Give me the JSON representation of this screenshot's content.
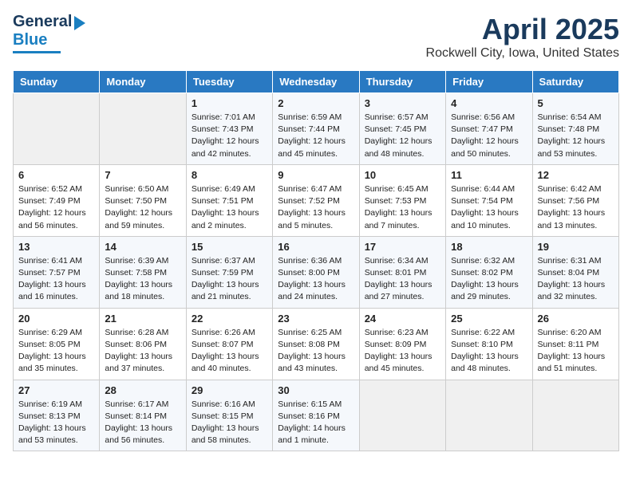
{
  "header": {
    "logo_line1": "General",
    "logo_line2": "Blue",
    "month_title": "April 2025",
    "location": "Rockwell City, Iowa, United States"
  },
  "days_of_week": [
    "Sunday",
    "Monday",
    "Tuesday",
    "Wednesday",
    "Thursday",
    "Friday",
    "Saturday"
  ],
  "weeks": [
    [
      {
        "day": "",
        "info": ""
      },
      {
        "day": "",
        "info": ""
      },
      {
        "day": "1",
        "info": "Sunrise: 7:01 AM\nSunset: 7:43 PM\nDaylight: 12 hours\nand 42 minutes."
      },
      {
        "day": "2",
        "info": "Sunrise: 6:59 AM\nSunset: 7:44 PM\nDaylight: 12 hours\nand 45 minutes."
      },
      {
        "day": "3",
        "info": "Sunrise: 6:57 AM\nSunset: 7:45 PM\nDaylight: 12 hours\nand 48 minutes."
      },
      {
        "day": "4",
        "info": "Sunrise: 6:56 AM\nSunset: 7:47 PM\nDaylight: 12 hours\nand 50 minutes."
      },
      {
        "day": "5",
        "info": "Sunrise: 6:54 AM\nSunset: 7:48 PM\nDaylight: 12 hours\nand 53 minutes."
      }
    ],
    [
      {
        "day": "6",
        "info": "Sunrise: 6:52 AM\nSunset: 7:49 PM\nDaylight: 12 hours\nand 56 minutes."
      },
      {
        "day": "7",
        "info": "Sunrise: 6:50 AM\nSunset: 7:50 PM\nDaylight: 12 hours\nand 59 minutes."
      },
      {
        "day": "8",
        "info": "Sunrise: 6:49 AM\nSunset: 7:51 PM\nDaylight: 13 hours\nand 2 minutes."
      },
      {
        "day": "9",
        "info": "Sunrise: 6:47 AM\nSunset: 7:52 PM\nDaylight: 13 hours\nand 5 minutes."
      },
      {
        "day": "10",
        "info": "Sunrise: 6:45 AM\nSunset: 7:53 PM\nDaylight: 13 hours\nand 7 minutes."
      },
      {
        "day": "11",
        "info": "Sunrise: 6:44 AM\nSunset: 7:54 PM\nDaylight: 13 hours\nand 10 minutes."
      },
      {
        "day": "12",
        "info": "Sunrise: 6:42 AM\nSunset: 7:56 PM\nDaylight: 13 hours\nand 13 minutes."
      }
    ],
    [
      {
        "day": "13",
        "info": "Sunrise: 6:41 AM\nSunset: 7:57 PM\nDaylight: 13 hours\nand 16 minutes."
      },
      {
        "day": "14",
        "info": "Sunrise: 6:39 AM\nSunset: 7:58 PM\nDaylight: 13 hours\nand 18 minutes."
      },
      {
        "day": "15",
        "info": "Sunrise: 6:37 AM\nSunset: 7:59 PM\nDaylight: 13 hours\nand 21 minutes."
      },
      {
        "day": "16",
        "info": "Sunrise: 6:36 AM\nSunset: 8:00 PM\nDaylight: 13 hours\nand 24 minutes."
      },
      {
        "day": "17",
        "info": "Sunrise: 6:34 AM\nSunset: 8:01 PM\nDaylight: 13 hours\nand 27 minutes."
      },
      {
        "day": "18",
        "info": "Sunrise: 6:32 AM\nSunset: 8:02 PM\nDaylight: 13 hours\nand 29 minutes."
      },
      {
        "day": "19",
        "info": "Sunrise: 6:31 AM\nSunset: 8:04 PM\nDaylight: 13 hours\nand 32 minutes."
      }
    ],
    [
      {
        "day": "20",
        "info": "Sunrise: 6:29 AM\nSunset: 8:05 PM\nDaylight: 13 hours\nand 35 minutes."
      },
      {
        "day": "21",
        "info": "Sunrise: 6:28 AM\nSunset: 8:06 PM\nDaylight: 13 hours\nand 37 minutes."
      },
      {
        "day": "22",
        "info": "Sunrise: 6:26 AM\nSunset: 8:07 PM\nDaylight: 13 hours\nand 40 minutes."
      },
      {
        "day": "23",
        "info": "Sunrise: 6:25 AM\nSunset: 8:08 PM\nDaylight: 13 hours\nand 43 minutes."
      },
      {
        "day": "24",
        "info": "Sunrise: 6:23 AM\nSunset: 8:09 PM\nDaylight: 13 hours\nand 45 minutes."
      },
      {
        "day": "25",
        "info": "Sunrise: 6:22 AM\nSunset: 8:10 PM\nDaylight: 13 hours\nand 48 minutes."
      },
      {
        "day": "26",
        "info": "Sunrise: 6:20 AM\nSunset: 8:11 PM\nDaylight: 13 hours\nand 51 minutes."
      }
    ],
    [
      {
        "day": "27",
        "info": "Sunrise: 6:19 AM\nSunset: 8:13 PM\nDaylight: 13 hours\nand 53 minutes."
      },
      {
        "day": "28",
        "info": "Sunrise: 6:17 AM\nSunset: 8:14 PM\nDaylight: 13 hours\nand 56 minutes."
      },
      {
        "day": "29",
        "info": "Sunrise: 6:16 AM\nSunset: 8:15 PM\nDaylight: 13 hours\nand 58 minutes."
      },
      {
        "day": "30",
        "info": "Sunrise: 6:15 AM\nSunset: 8:16 PM\nDaylight: 14 hours\nand 1 minute."
      },
      {
        "day": "",
        "info": ""
      },
      {
        "day": "",
        "info": ""
      },
      {
        "day": "",
        "info": ""
      }
    ]
  ]
}
